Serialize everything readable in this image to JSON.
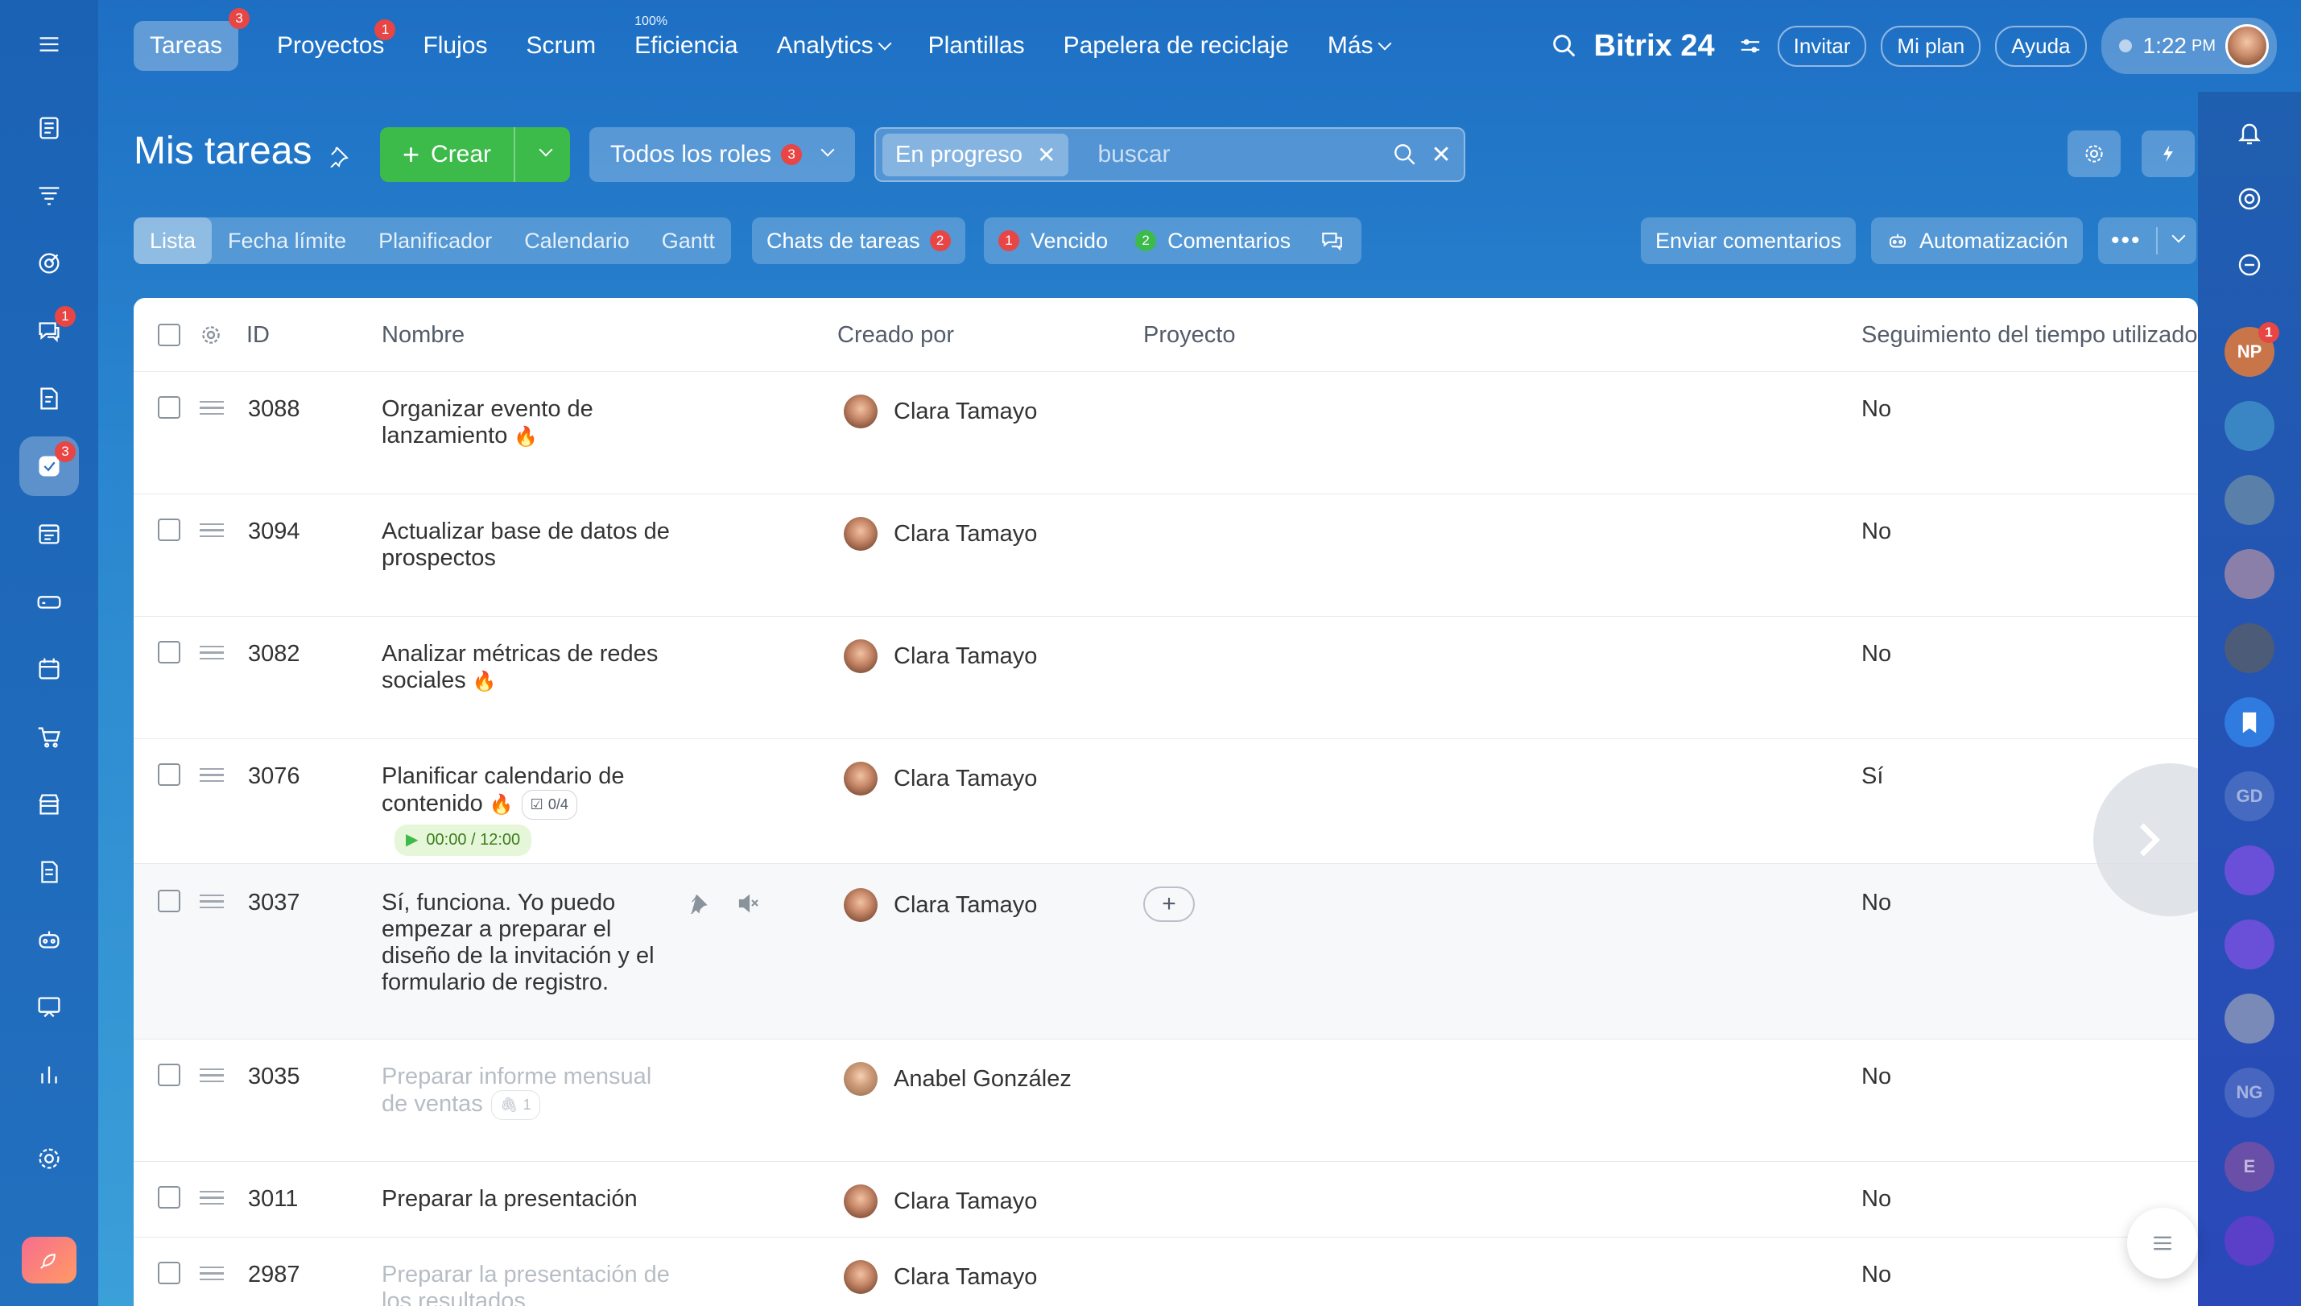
{
  "topnav": {
    "items": [
      {
        "label": "Tareas",
        "badge": "3"
      },
      {
        "label": "Proyectos",
        "badge": "1"
      },
      {
        "label": "Flujos"
      },
      {
        "label": "Scrum"
      },
      {
        "label": "Eficiencia",
        "sup": "100%"
      },
      {
        "label": "Analytics"
      },
      {
        "label": "Plantillas"
      },
      {
        "label": "Papelera de reciclaje"
      },
      {
        "label": "Más"
      }
    ],
    "brand": "Bitrix 24",
    "invite": "Invitar",
    "plan": "Mi plan",
    "help": "Ayuda",
    "time": "1:22",
    "ampm": "PM"
  },
  "left_rail": {
    "chat_badge": "1",
    "tasks_badge": "3"
  },
  "header": {
    "title": "Mis tareas",
    "create": "Crear",
    "roles": "Todos los roles",
    "roles_count": "3",
    "filter_chip": "En progreso",
    "search_placeholder": "buscar"
  },
  "toolbar": {
    "views": [
      "Lista",
      "Fecha límite",
      "Planificador",
      "Calendario",
      "Gantt"
    ],
    "chats": "Chats de tareas",
    "chats_count": "2",
    "overdue_count": "1",
    "overdue": "Vencido",
    "comments_count": "2",
    "comments": "Comentarios",
    "send_comments": "Enviar comentarios",
    "automation": "Automatización"
  },
  "table": {
    "columns": {
      "id": "ID",
      "name": "Nombre",
      "creator": "Creado por",
      "project": "Proyecto",
      "time_tracking": "Seguimiento del tiempo utilizado"
    },
    "rows": [
      {
        "id": "3088",
        "name": "Organizar evento de lanzamiento",
        "creator": "Clara Tamayo",
        "tracking": "No"
      },
      {
        "id": "3094",
        "name": "Actualizar base de datos de prospectos",
        "creator": "Clara Tamayo",
        "tracking": "No"
      },
      {
        "id": "3082",
        "name": "Analizar métricas de redes sociales",
        "creator": "Clara Tamayo",
        "tracking": "No"
      },
      {
        "id": "3076",
        "name": "Planificar calendario de contenido",
        "checklist": "0/4",
        "timer": "00:00 / 12:00",
        "creator": "Clara Tamayo",
        "tracking": "Sí"
      },
      {
        "id": "3037",
        "name": "Sí, funciona. Yo puedo empezar a preparar el diseño de la invitación y el formulario de registro.",
        "creator": "Clara Tamayo",
        "tracking": "No"
      },
      {
        "id": "3035",
        "name": "Preparar informe mensual de ventas",
        "attachments": "1",
        "creator": "Anabel González",
        "tracking": "No"
      },
      {
        "id": "3011",
        "name": "Preparar la presentación",
        "creator": "Clara Tamayo",
        "tracking": "No"
      },
      {
        "id": "2987",
        "name": "Preparar la presentación de los resultados",
        "creator": "Clara Tamayo",
        "tracking": "No"
      }
    ]
  },
  "right_rail": {
    "np_initials": "NP",
    "np_badge": "1",
    "gd_initials": "GD",
    "ng_initials": "NG",
    "e_initial": "E"
  }
}
